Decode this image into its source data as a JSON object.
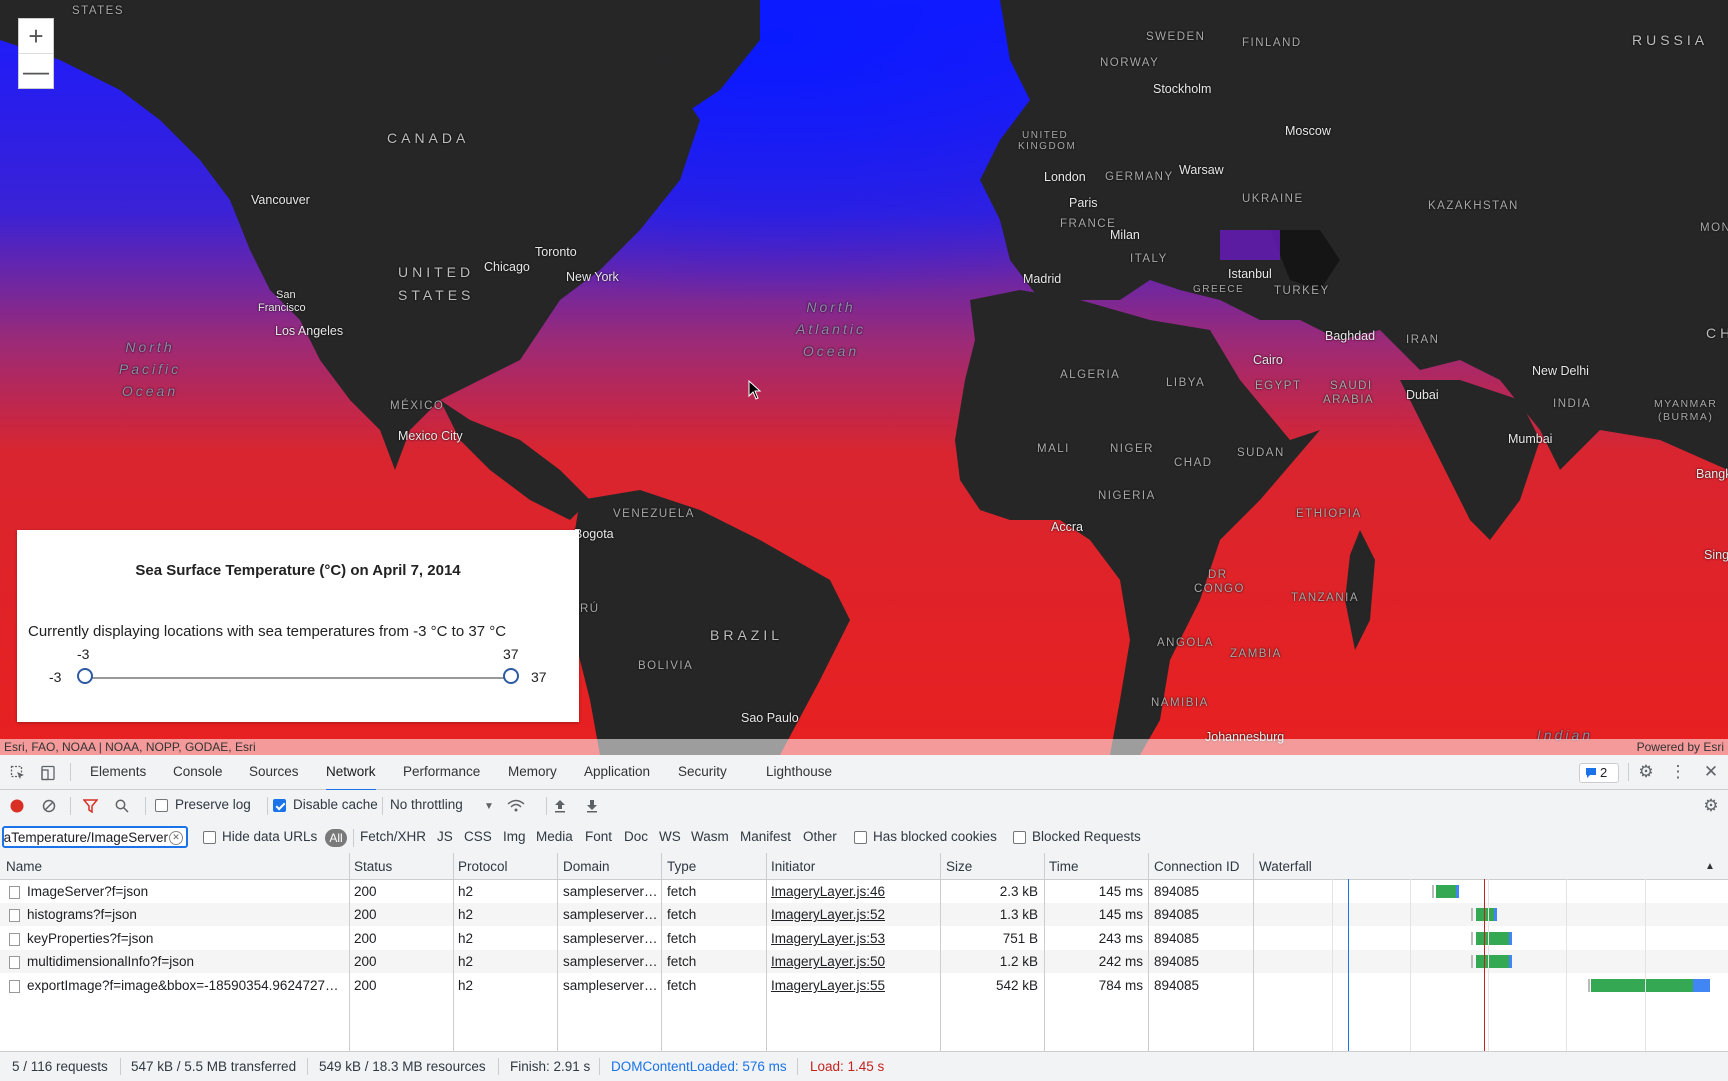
{
  "map": {
    "zoom_in": "+",
    "zoom_out": "—",
    "labels": {
      "states_top": "STATES",
      "canada": "CANADA",
      "united_states_1": "UNITED",
      "united_states_2": "STATES",
      "mexico": "MÉXICO",
      "venezuela": "VENEZUELA",
      "brazil": "BRAZIL",
      "bolivia": "BOLIVIA",
      "peru": "RÚ",
      "sweden": "SWEDEN",
      "finland": "FINLAND",
      "norway": "NORWAY",
      "russia": "RUSSIA",
      "uk_1": "UNITED",
      "uk_2": "KINGDOM",
      "germany": "GERMANY",
      "france": "FRANCE",
      "italy": "ITALY",
      "ukraine": "UKRAINE",
      "kazakhstan": "KAZAKHSTAN",
      "greece": "GREECE",
      "turkey": "TURKEY",
      "iran": "IRAN",
      "algeria": "ALGERIA",
      "libya": "LIBYA",
      "egypt": "EGYPT",
      "saudi_1": "SAUDI",
      "saudi_2": "ARABIA",
      "mali": "MALI",
      "niger": "NIGER",
      "chad": "CHAD",
      "sudan": "SUDAN",
      "nigeria": "NIGERIA",
      "ethiopia": "ETHIOPIA",
      "drc_1": "DR",
      "drc_2": "CONGO",
      "tanzania": "TANZANIA",
      "angola": "ANGOLA",
      "zambia": "ZAMBIA",
      "namibia": "NAMIBIA",
      "india": "INDIA",
      "myanmar_1": "MYANMAR",
      "myanmar_2": "(BURMA)",
      "ch": "CH",
      "mon": "MON",
      "north_pacific": "North Pacific Ocean",
      "north_atlantic": "North Atlantic Ocean",
      "indian": "Indian",
      "vancouver": "Vancouver",
      "san_francisco_1": "San",
      "san_francisco_2": "Francisco",
      "los_angeles": "Los Angeles",
      "chicago": "Chicago",
      "toronto": "Toronto",
      "new_york": "New York",
      "mexico_city": "Mexico City",
      "bogota": "Bogota",
      "sao_paulo": "Sao Paulo",
      "stockholm": "Stockholm",
      "moscow": "Moscow",
      "london": "London",
      "warsaw": "Warsaw",
      "paris": "Paris",
      "milan": "Milan",
      "madrid": "Madrid",
      "istanbul": "Istanbul",
      "baghdad": "Baghdad",
      "cairo": "Cairo",
      "dubai": "Dubai",
      "new_delhi": "New Delhi",
      "mumbai": "Mumbai",
      "accra": "Accra",
      "johannesburg": "Johannesburg",
      "bangk": "Bangk",
      "sing": "Sing"
    },
    "attribution_left": "Esri, FAO, NOAA | NOAA, NOPP, GODAE, Esri",
    "attribution_right": "Powered by Esri"
  },
  "legend": {
    "title": "Sea Surface Temperature (°C) on April 7, 2014",
    "description": "Currently displaying locations with sea temperatures from -3 °C to 37 °C",
    "min_label": "-3",
    "max_label": "37",
    "min_value": "-3",
    "max_value": "37",
    "range_min": -3,
    "range_max": 37
  },
  "devtools": {
    "tabs": [
      "Elements",
      "Console",
      "Sources",
      "Network",
      "Performance",
      "Memory",
      "Application",
      "Security",
      "Lighthouse"
    ],
    "active_tab": "Network",
    "issues_count": "2",
    "toolbar": {
      "preserve_log": "Preserve log",
      "disable_cache": "Disable cache",
      "throttling": "No throttling"
    },
    "filter": {
      "value": "eaTemperature/ImageServer",
      "hide_data_urls": "Hide data URLs",
      "all": "All",
      "types": [
        "Fetch/XHR",
        "JS",
        "CSS",
        "Img",
        "Media",
        "Font",
        "Doc",
        "WS",
        "Wasm",
        "Manifest",
        "Other"
      ],
      "has_blocked_cookies": "Has blocked cookies",
      "blocked_requests": "Blocked Requests"
    },
    "columns": [
      "Name",
      "Status",
      "Protocol",
      "Domain",
      "Type",
      "Initiator",
      "Size",
      "Time",
      "Connection ID",
      "Waterfall"
    ],
    "rows": [
      {
        "name": "ImageServer?f=json",
        "status": "200",
        "protocol": "h2",
        "domain": "sampleserver…",
        "type": "fetch",
        "initiator": "ImageryLayer.js:46",
        "size": "2.3 kB",
        "time": "145 ms",
        "conn": "894085"
      },
      {
        "name": "histograms?f=json",
        "status": "200",
        "protocol": "h2",
        "domain": "sampleserver…",
        "type": "fetch",
        "initiator": "ImageryLayer.js:52",
        "size": "1.3 kB",
        "time": "145 ms",
        "conn": "894085"
      },
      {
        "name": "keyProperties?f=json",
        "status": "200",
        "protocol": "h2",
        "domain": "sampleserver…",
        "type": "fetch",
        "initiator": "ImageryLayer.js:53",
        "size": "751 B",
        "time": "243 ms",
        "conn": "894085"
      },
      {
        "name": "multidimensionalInfo?f=json",
        "status": "200",
        "protocol": "h2",
        "domain": "sampleserver…",
        "type": "fetch",
        "initiator": "ImageryLayer.js:50",
        "size": "1.2 kB",
        "time": "242 ms",
        "conn": "894085"
      },
      {
        "name": "exportImage?f=image&bbox=-18590354.9624727…",
        "status": "200",
        "protocol": "h2",
        "domain": "sampleserver…",
        "type": "fetch",
        "initiator": "ImageryLayer.js:55",
        "size": "542 kB",
        "time": "784 ms",
        "conn": "894085"
      }
    ],
    "status_bar": {
      "requests": "5 / 116 requests",
      "transferred": "547 kB / 5.5 MB transferred",
      "resources": "549 kB / 18.3 MB resources",
      "finish": "Finish: 2.91 s",
      "dcl": "DOMContentLoaded: 576 ms",
      "load": "Load: 1.45 s"
    },
    "colors": {
      "dcl": "#1a73e8",
      "load": "#c5221f",
      "waterfall_green": "#34a853",
      "waterfall_blue": "#4285f4"
    }
  }
}
